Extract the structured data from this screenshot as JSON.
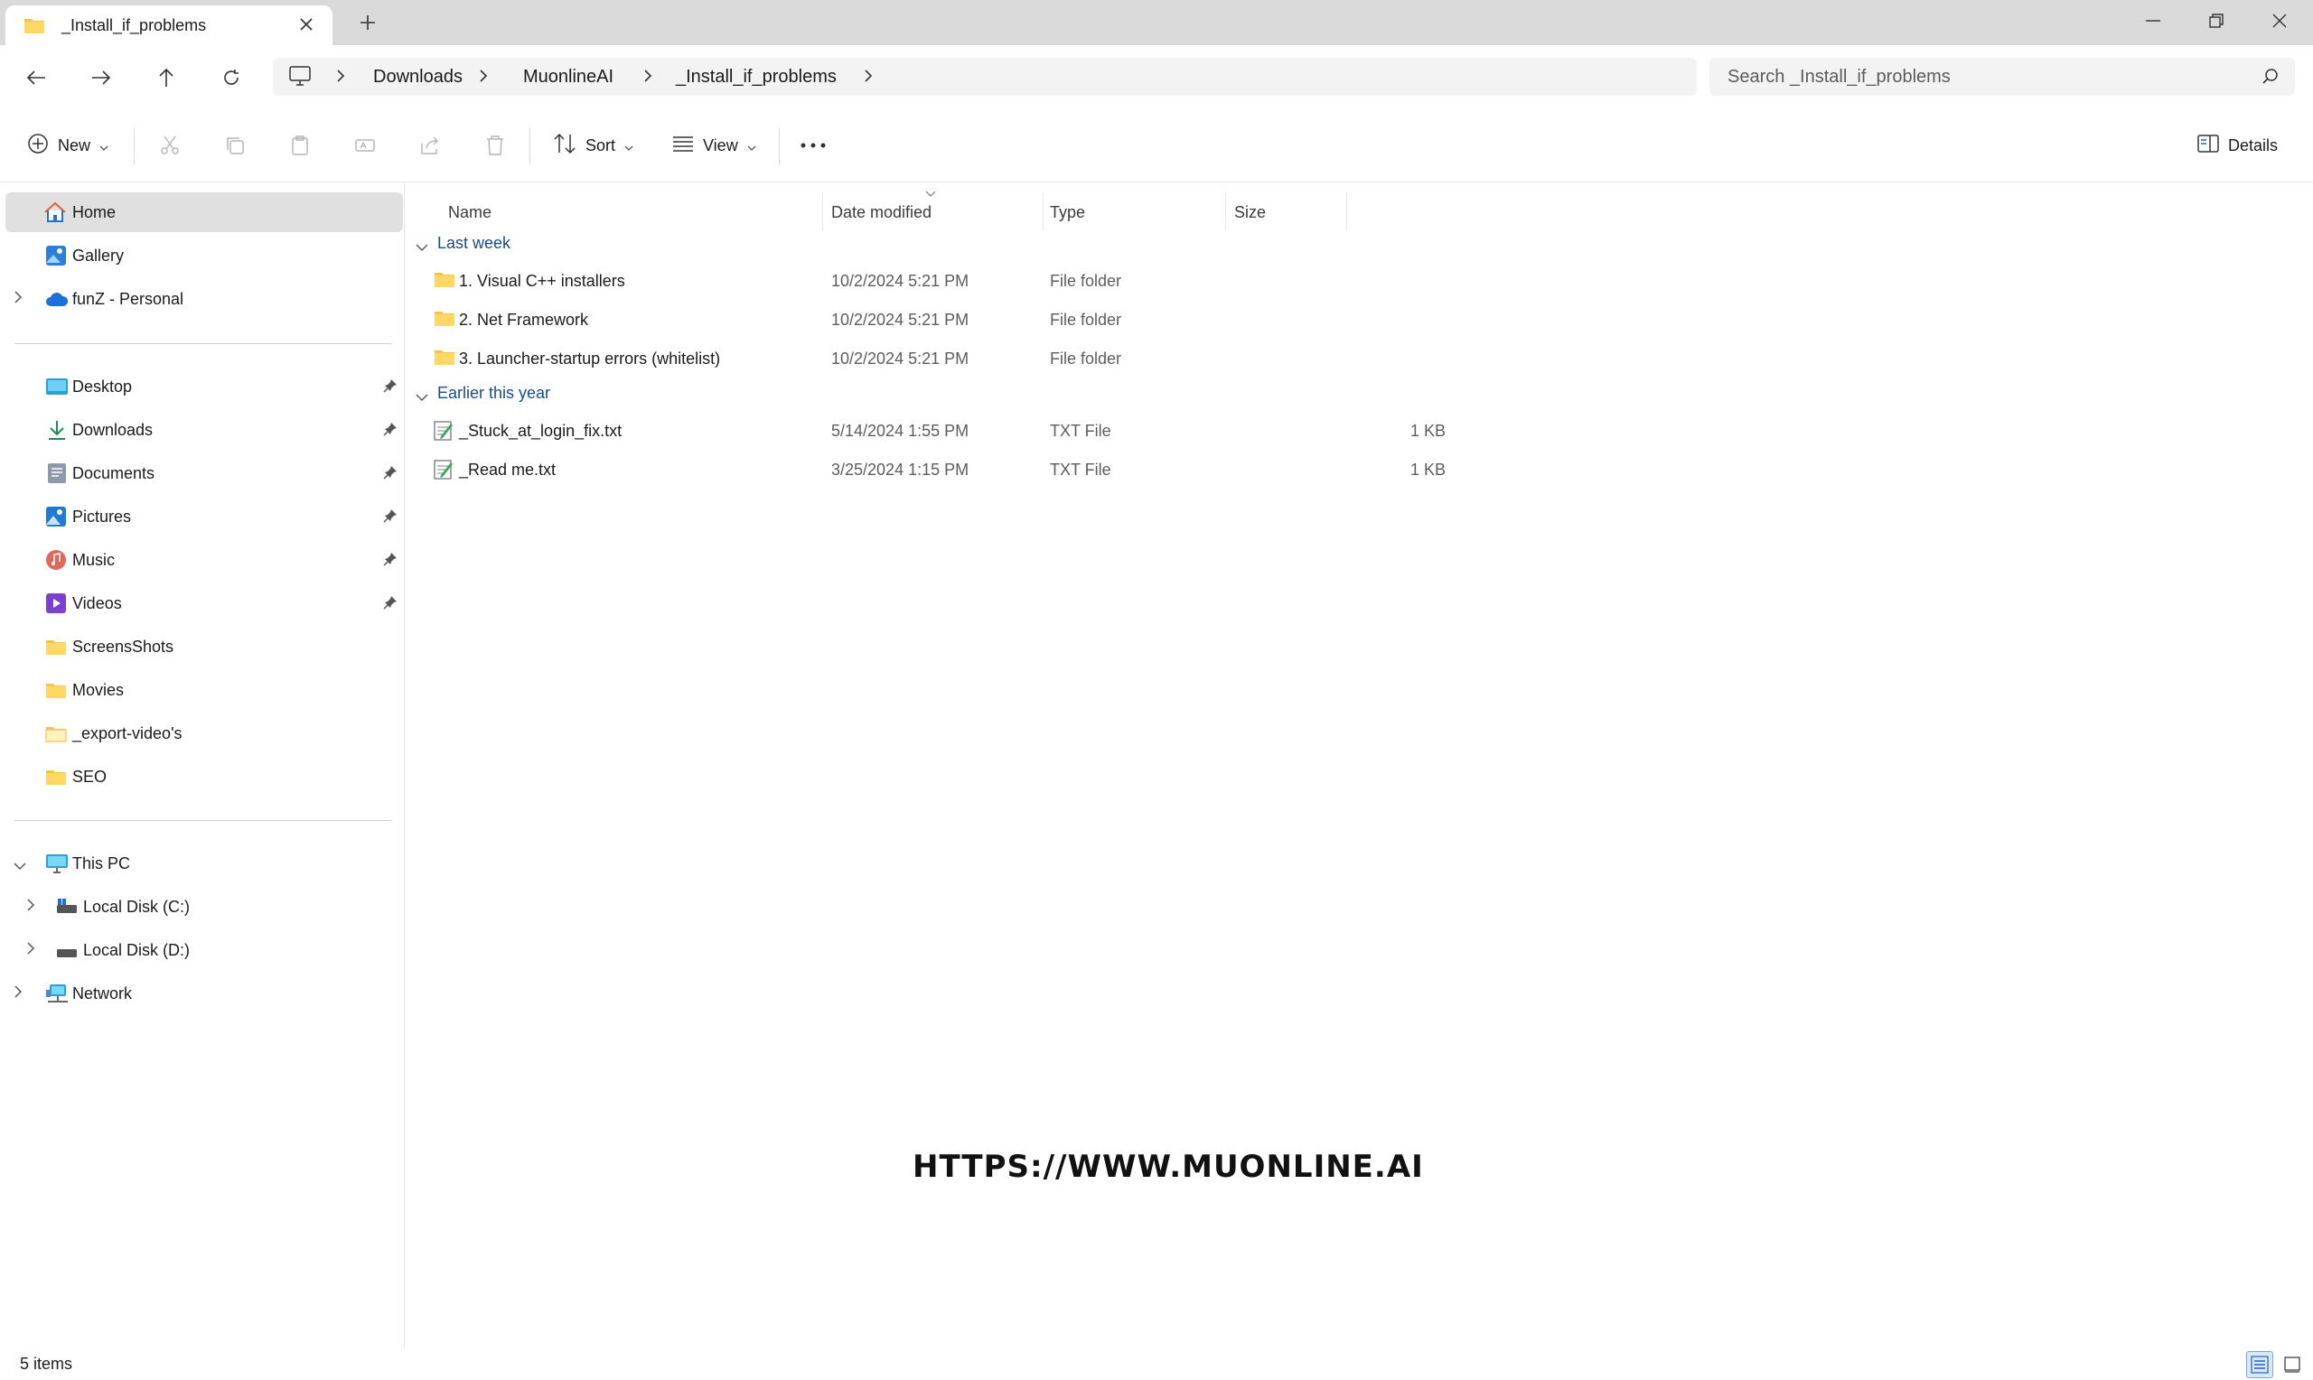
{
  "window": {
    "tab_title": "_Install_if_problems"
  },
  "address": {
    "crumbs": [
      "Downloads",
      "MuonlineAI",
      "_Install_if_problems"
    ],
    "search_placeholder": "Search _Install_if_problems"
  },
  "toolbar": {
    "new_label": "New",
    "sort_label": "Sort",
    "view_label": "View",
    "details_label": "Details"
  },
  "sidebar": {
    "top": [
      {
        "label": "Home",
        "icon": "home-icon"
      },
      {
        "label": "Gallery",
        "icon": "gallery-icon"
      },
      {
        "label": "funZ - Personal",
        "icon": "onedrive-icon"
      }
    ],
    "quick": [
      {
        "label": "Desktop",
        "icon": "desktop-icon"
      },
      {
        "label": "Downloads",
        "icon": "download-icon"
      },
      {
        "label": "Documents",
        "icon": "documents-icon"
      },
      {
        "label": "Pictures",
        "icon": "pictures-icon"
      },
      {
        "label": "Music",
        "icon": "music-icon"
      },
      {
        "label": "Videos",
        "icon": "videos-icon"
      },
      {
        "label": "ScreensShots",
        "icon": "folder-icon"
      },
      {
        "label": "Movies",
        "icon": "folder-icon"
      },
      {
        "label": "_export-video's",
        "icon": "folder-icon"
      },
      {
        "label": "SEO",
        "icon": "folder-icon"
      }
    ],
    "pc": [
      {
        "label": "This PC",
        "icon": "pc-icon"
      },
      {
        "label": "Local Disk (C:)",
        "icon": "drive-icon"
      },
      {
        "label": "Local Disk (D:)",
        "icon": "drive-icon"
      },
      {
        "label": "Network",
        "icon": "network-icon"
      }
    ]
  },
  "columns": {
    "name": "Name",
    "date": "Date modified",
    "type": "Type",
    "size": "Size"
  },
  "groups": [
    {
      "label": "Last week",
      "items": [
        {
          "name": "1. Visual C++ installers",
          "date": "10/2/2024 5:21 PM",
          "type": "File folder",
          "size": ""
        },
        {
          "name": "2. Net Framework",
          "date": "10/2/2024 5:21 PM",
          "type": "File folder",
          "size": ""
        },
        {
          "name": "3. Launcher-startup errors (whitelist)",
          "date": "10/2/2024 5:21 PM",
          "type": "File folder",
          "size": ""
        }
      ]
    },
    {
      "label": "Earlier this year",
      "items": [
        {
          "name": "_Stuck_at_login_fix.txt",
          "date": "5/14/2024 1:55 PM",
          "type": "TXT File",
          "size": "1 KB"
        },
        {
          "name": "_Read me.txt",
          "date": "3/25/2024 1:15 PM",
          "type": "TXT File",
          "size": "1 KB"
        }
      ]
    }
  ],
  "watermark": "HTTPS://WWW.MUONLINE.AI",
  "status": {
    "count": "5 items"
  },
  "colors": {
    "folder": "#f4c54a",
    "accent": "#1a4a8a",
    "selected": "#e0e0e0"
  }
}
